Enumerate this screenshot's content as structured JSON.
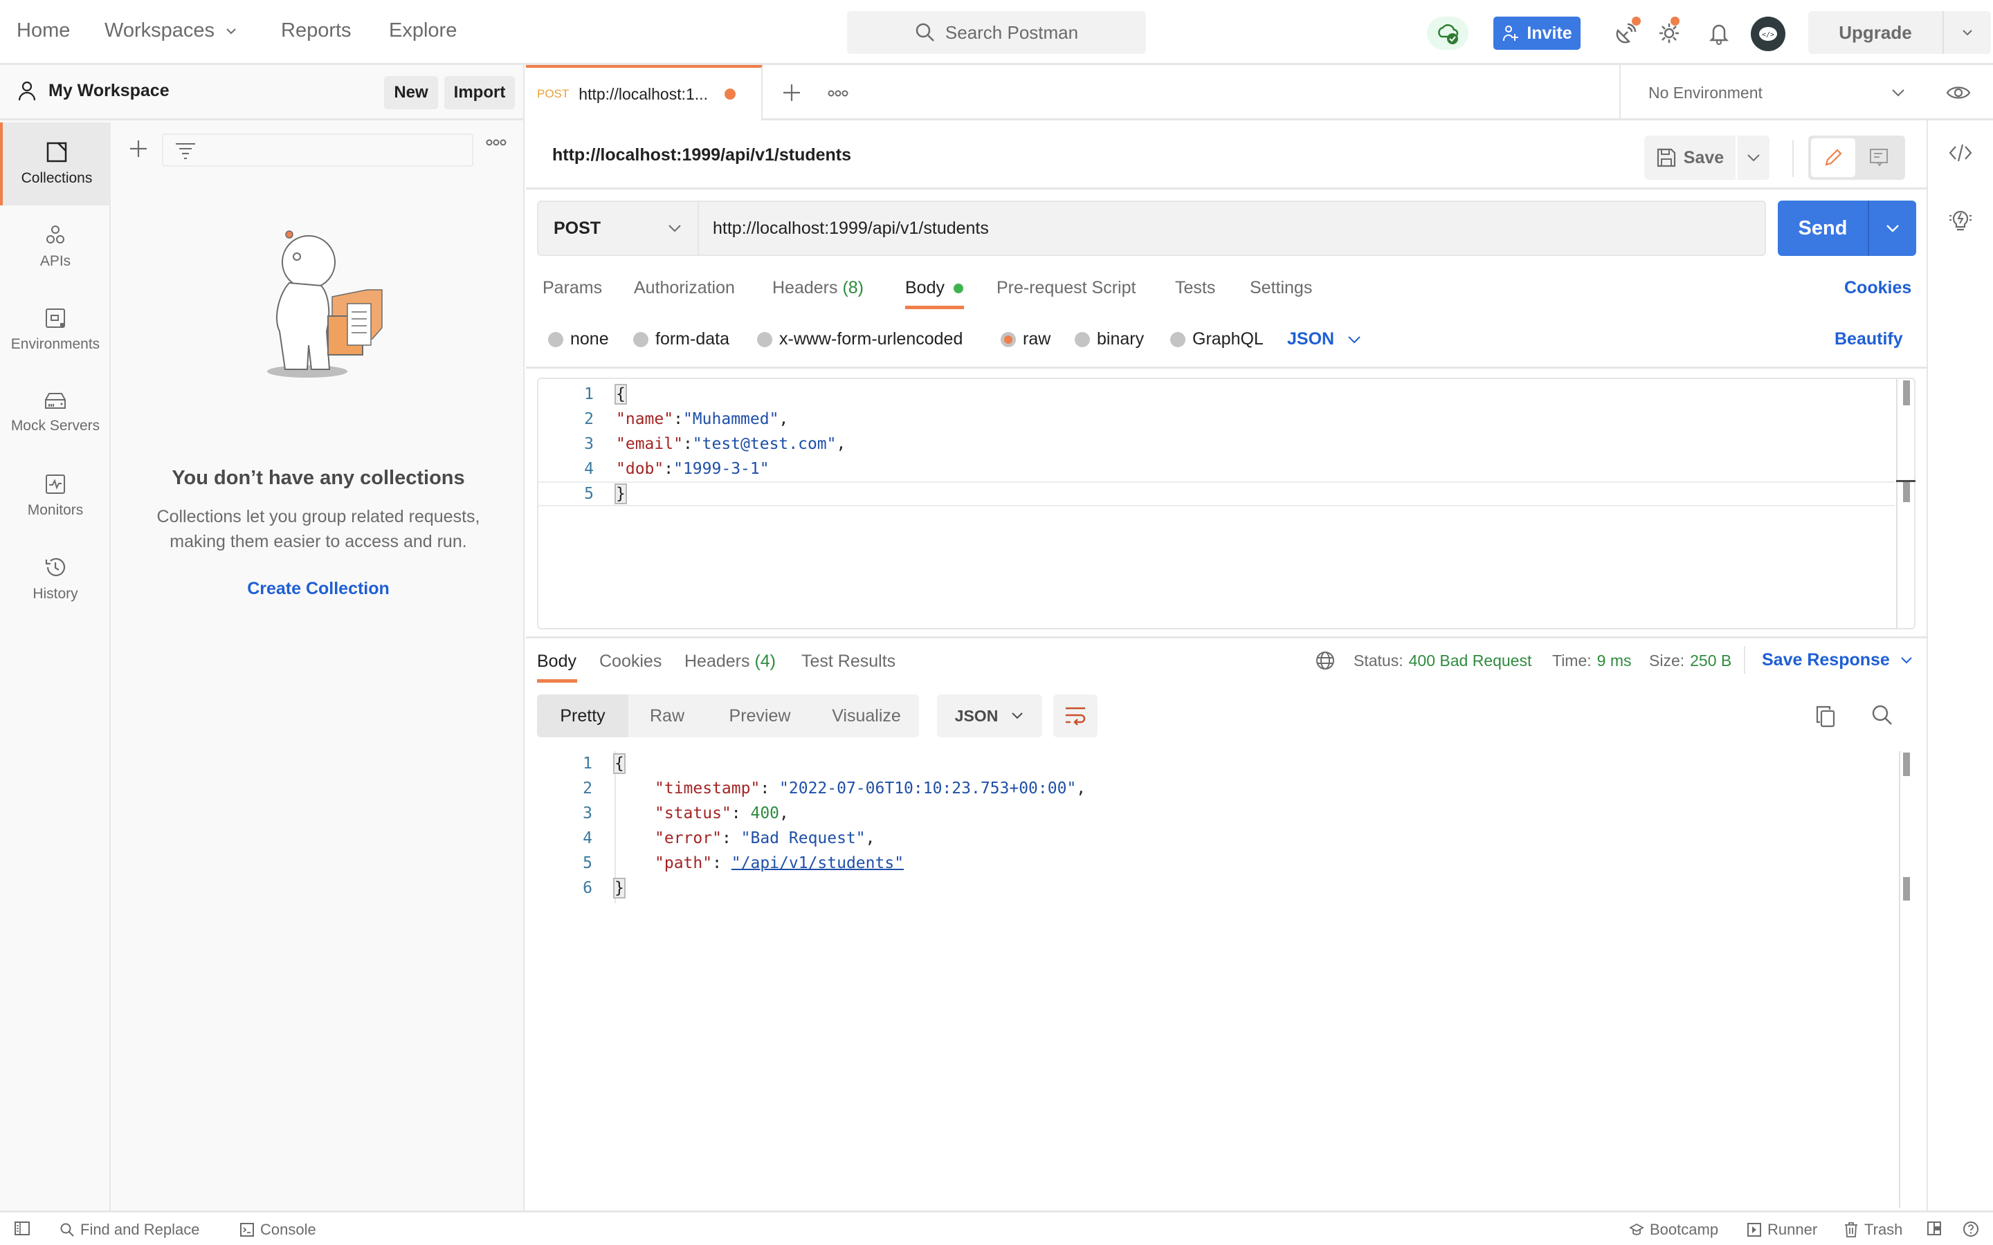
{
  "header": {
    "nav": [
      {
        "label": "Home"
      },
      {
        "label": "Workspaces",
        "has_caret": true
      },
      {
        "label": "Reports"
      },
      {
        "label": "Explore"
      }
    ],
    "search_placeholder": "Search Postman",
    "invite_label": "Invite",
    "upgrade_label": "Upgrade",
    "icons": [
      "cloud-sync-icon",
      "satellite-icon",
      "settings-icon",
      "bell-icon",
      "avatar"
    ]
  },
  "workspace": {
    "title": "My Workspace",
    "new_label": "New",
    "import_label": "Import"
  },
  "rail": {
    "items": [
      {
        "label": "Collections",
        "icon": "collections-icon",
        "active": true
      },
      {
        "label": "APIs",
        "icon": "apis-icon"
      },
      {
        "label": "Environments",
        "icon": "environments-icon"
      },
      {
        "label": "Mock Servers",
        "icon": "mock-servers-icon"
      },
      {
        "label": "Monitors",
        "icon": "monitors-icon"
      },
      {
        "label": "History",
        "icon": "history-icon"
      }
    ]
  },
  "collections": {
    "filter_value": "",
    "empty_title": "You don’t have any collections",
    "empty_sub_line1": "Collections let you group related requests,",
    "empty_sub_line2": "making them easier to access and run.",
    "create_label": "Create Collection"
  },
  "tabs": {
    "open": [
      {
        "method": "POST",
        "label": "http://localhost:1...",
        "unsaved": true
      }
    ],
    "environment": "No Environment"
  },
  "request": {
    "name": "http://localhost:1999/api/v1/students",
    "save_label": "Save",
    "method": "POST",
    "url": "http://localhost:1999/api/v1/students",
    "send_label": "Send",
    "sub_tabs": [
      {
        "label": "Params"
      },
      {
        "label": "Authorization"
      },
      {
        "label": "Headers",
        "count": "(8)"
      },
      {
        "label": "Body",
        "active": true,
        "indicator": true
      },
      {
        "label": "Pre-request Script"
      },
      {
        "label": "Tests"
      },
      {
        "label": "Settings"
      }
    ],
    "cookies_label": "Cookies",
    "body_types": [
      {
        "label": "none"
      },
      {
        "label": "form-data"
      },
      {
        "label": "x-www-form-urlencoded"
      },
      {
        "label": "raw",
        "selected": true
      },
      {
        "label": "binary"
      },
      {
        "label": "GraphQL"
      }
    ],
    "body_format": "JSON",
    "beautify_label": "Beautify",
    "body_lines": [
      {
        "n": "1",
        "text": "{"
      },
      {
        "n": "2",
        "key": "\"name\"",
        "sep": ":",
        "val": "\"Muhammed\"",
        "tail": ","
      },
      {
        "n": "3",
        "key": "\"email\"",
        "sep": ":",
        "val": "\"test@test.com\"",
        "tail": ","
      },
      {
        "n": "4",
        "key": "\"dob\"",
        "sep": ":",
        "val": "\"1999-3-1\"",
        "tail": ""
      },
      {
        "n": "5",
        "text": "}"
      }
    ]
  },
  "response": {
    "tabs": [
      {
        "label": "Body",
        "active": true
      },
      {
        "label": "Cookies"
      },
      {
        "label": "Headers",
        "count": "(4)"
      },
      {
        "label": "Test Results"
      }
    ],
    "status_label": "Status:",
    "status_value": "400 Bad Request",
    "time_label": "Time:",
    "time_value": "9 ms",
    "size_label": "Size:",
    "size_value": "250 B",
    "save_response_label": "Save Response",
    "views": [
      "Pretty",
      "Raw",
      "Preview",
      "Visualize"
    ],
    "active_view": "Pretty",
    "format": "JSON",
    "lines": [
      {
        "n": "1",
        "text": "{"
      },
      {
        "n": "2",
        "key": "\"timestamp\"",
        "val": "\"2022-07-06T10:10:23.753+00:00\"",
        "type": "string",
        "tail": ","
      },
      {
        "n": "3",
        "key": "\"status\"",
        "val": "400",
        "type": "number",
        "tail": ","
      },
      {
        "n": "4",
        "key": "\"error\"",
        "val": "\"Bad Request\"",
        "type": "string",
        "tail": ","
      },
      {
        "n": "5",
        "key": "\"path\"",
        "val": "\"/api/v1/students\"",
        "type": "link",
        "tail": ""
      },
      {
        "n": "6",
        "text": "}"
      }
    ]
  },
  "statusbar": {
    "find_replace": "Find and Replace",
    "console": "Console",
    "bootcamp": "Bootcamp",
    "runner": "Runner",
    "trash": "Trash"
  },
  "colors": {
    "accent_orange": "#ef7f4b",
    "primary_blue": "#3a78e2",
    "link_blue": "#1f5fd4",
    "success_green": "#2e8b3e"
  }
}
